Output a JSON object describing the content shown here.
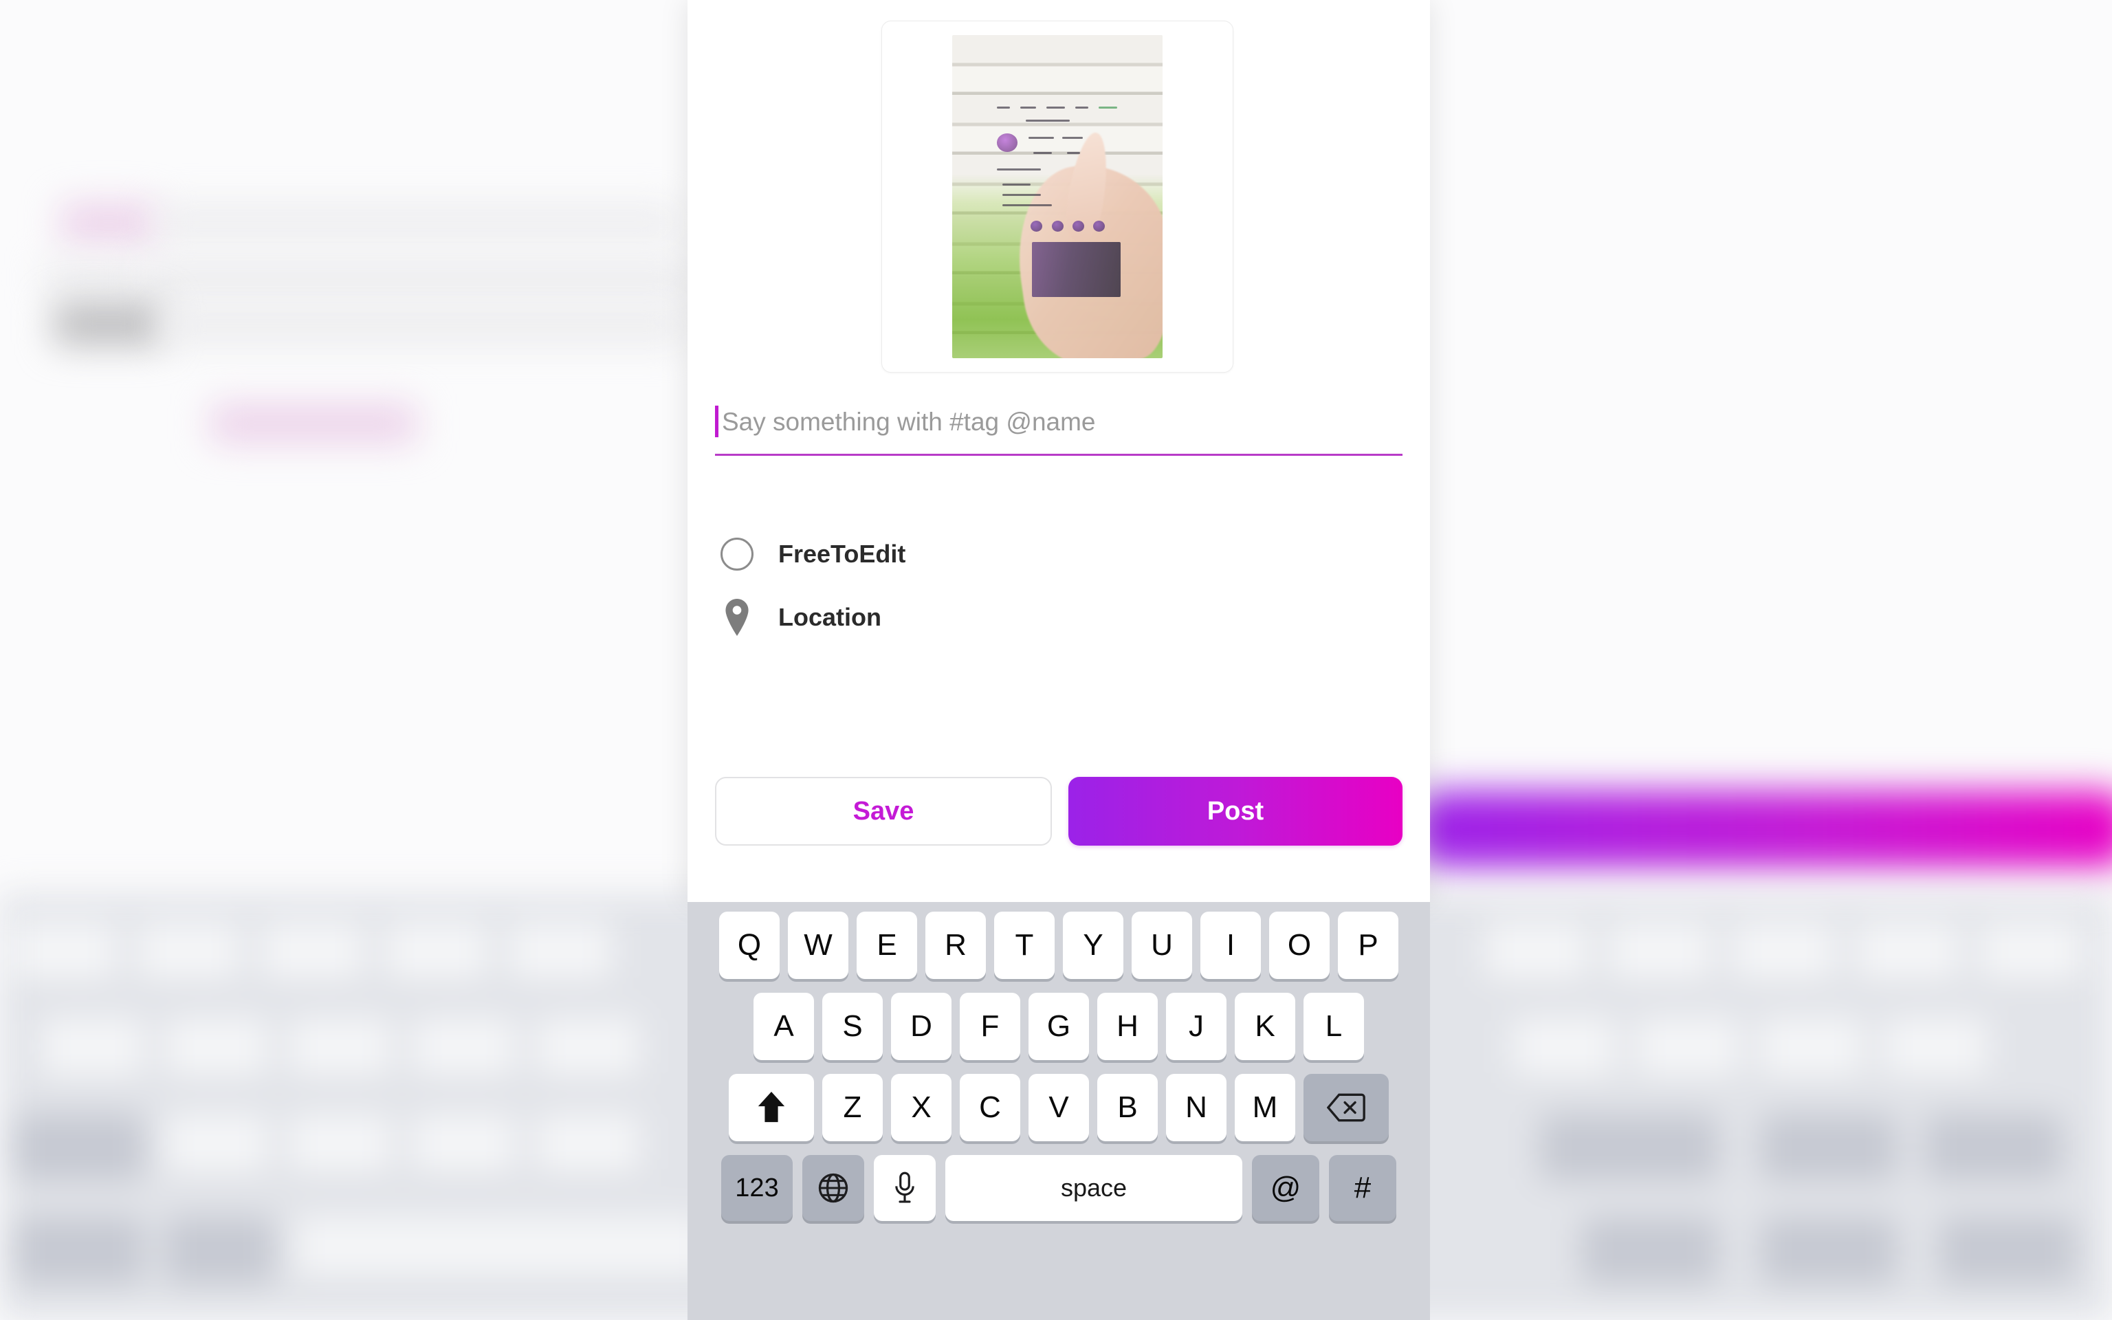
{
  "panel": {
    "image_card": {
      "alt_description": "hand holding translucent phone showing social post over white brick wall with green moss"
    },
    "caption_input": {
      "placeholder": "Say something with #tag @name",
      "value": "",
      "caret_visible": true,
      "underline_color": "#b83bc8",
      "caret_color": "#c01ad0"
    },
    "options": [
      {
        "icon": "circle-radio-icon",
        "label": "FreeToEdit",
        "selected": false
      },
      {
        "icon": "location-pin-icon",
        "label": "Location",
        "selected": false
      }
    ],
    "actions": {
      "save_label": "Save",
      "save_text_color": "#c41ad6",
      "post_label": "Post",
      "post_gradient_from": "#9b22e8",
      "post_gradient_to": "#e800c4"
    }
  },
  "keyboard": {
    "background_color": "#d2d4da",
    "key_color": "#ffffff",
    "fn_key_color": "#adb2bd",
    "row1": [
      "Q",
      "W",
      "E",
      "R",
      "T",
      "Y",
      "U",
      "I",
      "O",
      "P"
    ],
    "row2": [
      "A",
      "S",
      "D",
      "F",
      "G",
      "H",
      "J",
      "K",
      "L"
    ],
    "row3_letters": [
      "Z",
      "X",
      "C",
      "V",
      "B",
      "N",
      "M"
    ],
    "shift_icon": "shift-arrow-icon",
    "backspace_icon": "backspace-delete-icon",
    "row4": {
      "numbers_label": "123",
      "globe_icon": "globe-language-icon",
      "mic_icon": "microphone-icon",
      "space_label": "space",
      "at_label": "@",
      "hash_label": "#"
    }
  },
  "background": {
    "blurred": true,
    "accent_gradient_from": "#9b22e8",
    "accent_gradient_to": "#e800c4"
  }
}
